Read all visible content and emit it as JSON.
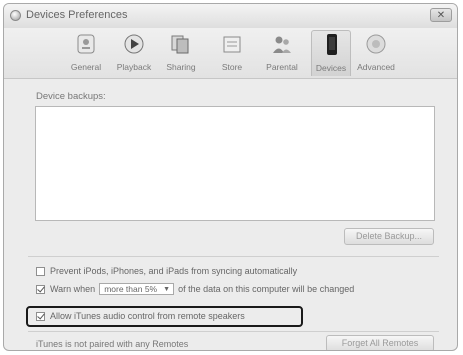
{
  "window": {
    "title": "Devices Preferences",
    "close_glyph": "✕"
  },
  "toolbar": {
    "tabs": [
      {
        "label": "General",
        "icon": "general-icon"
      },
      {
        "label": "Playback",
        "icon": "playback-icon"
      },
      {
        "label": "Sharing",
        "icon": "sharing-icon"
      },
      {
        "label": "Store",
        "icon": "store-icon"
      },
      {
        "label": "Parental",
        "icon": "parental-icon"
      },
      {
        "label": "Devices",
        "icon": "devices-icon",
        "active": true
      },
      {
        "label": "Advanced",
        "icon": "advanced-icon"
      }
    ]
  },
  "main": {
    "backups_label": "Device backups:",
    "delete_backup_button": "Delete Backup...",
    "prevent_sync_label": "Prevent iPods, iPhones, and iPads from syncing automatically",
    "prevent_sync_checked": false,
    "warn_prefix": "Warn when",
    "warn_select_value": "more than 5%",
    "warn_suffix": "of the data on this computer will be changed",
    "warn_checked": true,
    "allow_audio_label": "Allow iTunes audio control from remote speakers",
    "allow_audio_checked": true,
    "status_text": "iTunes is not paired with any Remotes",
    "forget_remotes_button": "Forget All Remotes"
  },
  "colors": {
    "highlight_border": "#1a1a1a",
    "window_bg": "#ececec"
  }
}
